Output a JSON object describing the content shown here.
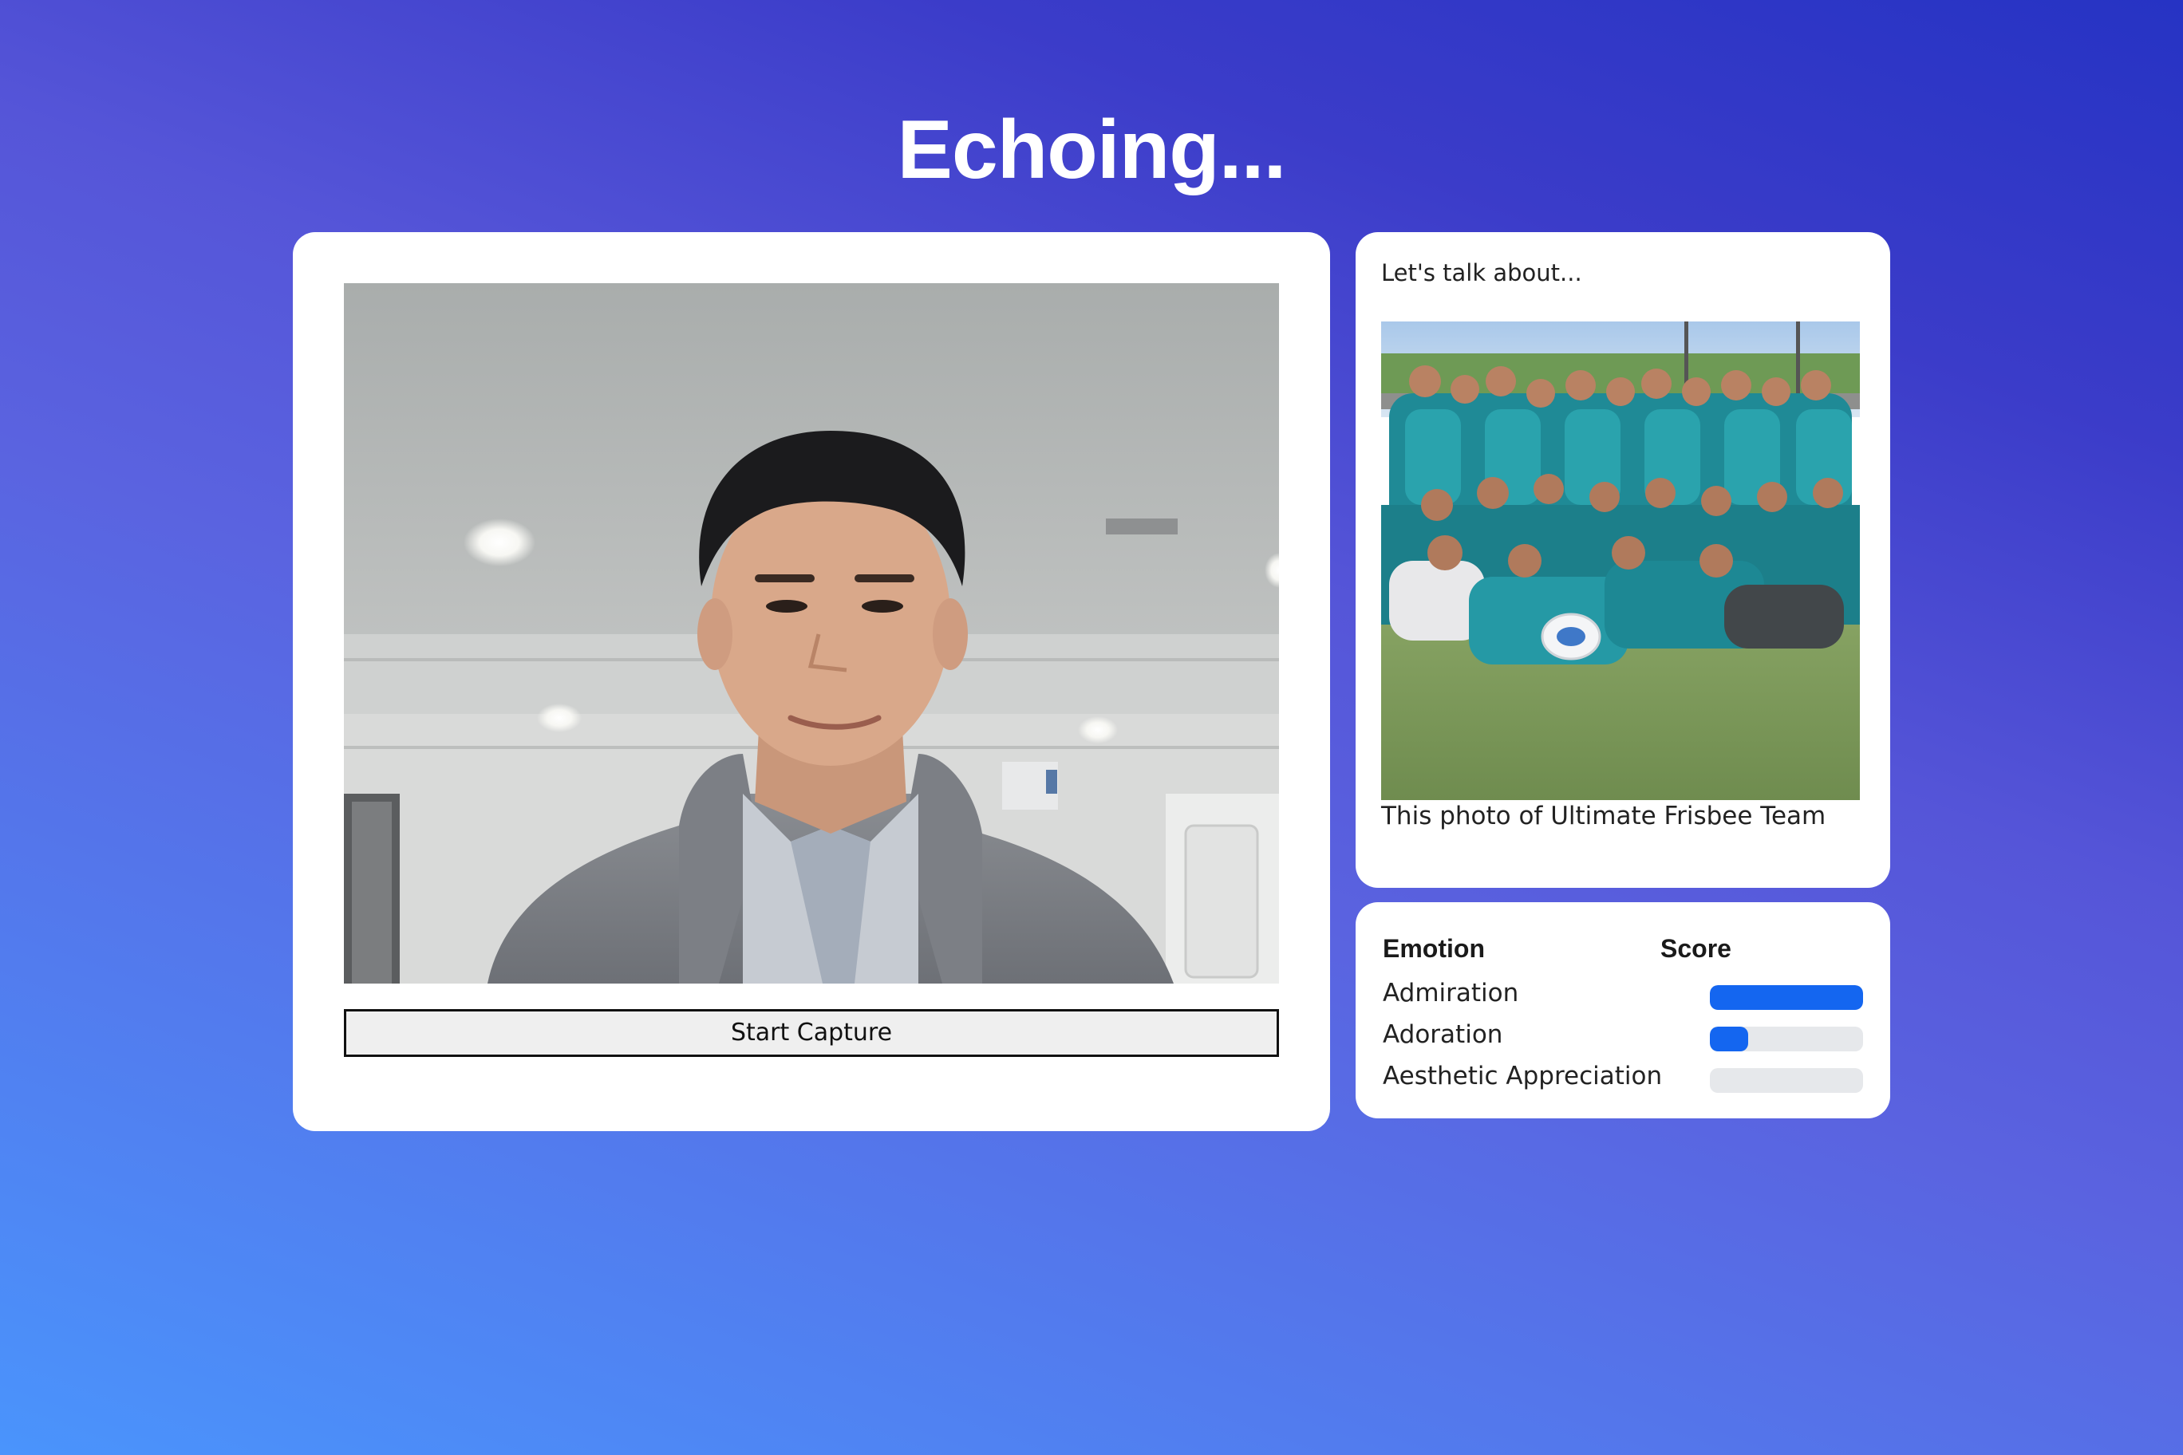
{
  "header": {
    "title": "Echoing..."
  },
  "video": {
    "capture_label": "Start Capture"
  },
  "topic": {
    "prompt": "Let's talk about...",
    "caption": "This photo of Ultimate Frisbee Team"
  },
  "emotions": {
    "col_emotion": "Emotion",
    "col_score": "Score",
    "accent_color": "#1466f0",
    "track_color": "#e6e8eb",
    "items": [
      {
        "label": "Admiration",
        "score": 1.0
      },
      {
        "label": "Adoration",
        "score": 0.25
      },
      {
        "label": "Aesthetic Appreciation",
        "score": 0.0
      }
    ]
  }
}
